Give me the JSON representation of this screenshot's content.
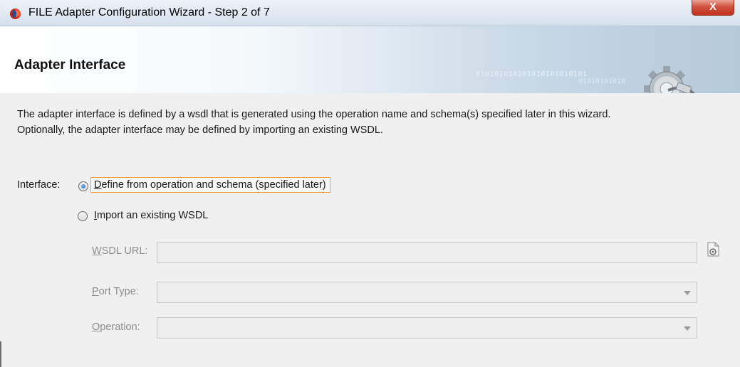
{
  "window": {
    "title": "FILE Adapter Configuration Wizard - Step 2 of 7",
    "close_label": "X"
  },
  "header": {
    "title": "Adapter Interface",
    "binary_text": "010101010101010101010101",
    "binary_text2": "01010101010"
  },
  "main": {
    "description_line1": "The adapter interface is defined by a wsdl that is generated using the operation name and schema(s) specified later in this wizard.",
    "description_line2": "Optionally, the adapter interface may be defined by importing an existing WSDL.",
    "interface_label": "Interface:",
    "options": [
      {
        "mnemonic": "D",
        "rest": "efine from operation and schema (specified later)",
        "selected": true
      },
      {
        "mnemonic": "I",
        "rest": "mport an existing WSDL",
        "selected": false
      }
    ],
    "fields": [
      {
        "mnemonic": "W",
        "rest": "SDL URL:",
        "value": "",
        "type": "text"
      },
      {
        "mnemonic": "P",
        "rest": "ort Type:",
        "value": "",
        "type": "select"
      },
      {
        "mnemonic": "O",
        "rest": "peration:",
        "value": "",
        "type": "select"
      }
    ]
  },
  "colors": {
    "accent_focus": "#f0a030",
    "close_button": "#c2331f",
    "disabled_text": "#8c8c8c"
  },
  "icons": [
    "app-icon",
    "close-icon",
    "gear-plug-icon",
    "browse-icon",
    "chevron-down-icon"
  ]
}
